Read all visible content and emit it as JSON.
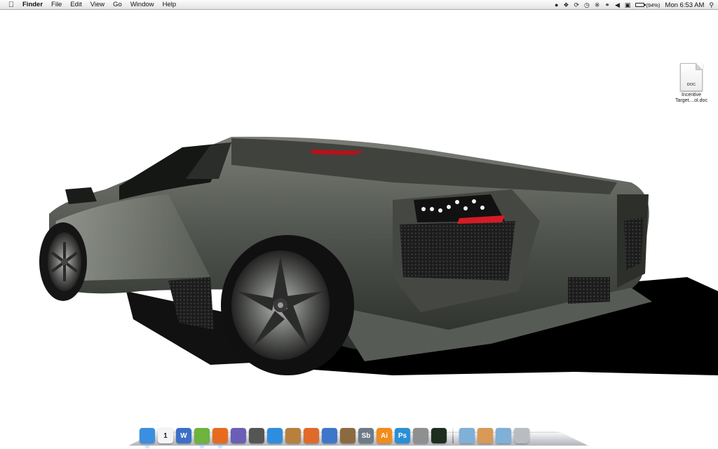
{
  "menubar": {
    "apple_icon": "apple-logo",
    "app_name": "Finder",
    "menus": [
      "File",
      "Edit",
      "View",
      "Go",
      "Window",
      "Help"
    ],
    "status": {
      "icons": [
        "evernote-icon",
        "dropbox-icon",
        "sync-icon",
        "time-machine-icon",
        "bluetooth-icon",
        "wifi-icon",
        "volume-icon",
        "input-menu-icon"
      ],
      "battery_percent": "(94%)",
      "battery_level": 0.94,
      "clock": "Mon 6:53 AM",
      "search_icon": "spotlight-icon"
    }
  },
  "desktop": {
    "wallpaper": "Lamborghini Reventon rear view",
    "icons": [
      {
        "type_tag": "DOC",
        "label_line1": "Incentive",
        "label_line2": "Target....ol.doc"
      }
    ]
  },
  "dock": {
    "apps": [
      {
        "name": "finder-icon",
        "label": "",
        "color": "#3a8fe0",
        "running": true
      },
      {
        "name": "ical-icon",
        "label": "1",
        "color": "#f4f4f4",
        "running": false
      },
      {
        "name": "word-icon",
        "label": "W",
        "color": "#3c6fc7",
        "running": false
      },
      {
        "name": "evernote-icon",
        "label": "",
        "color": "#6cb43d",
        "running": true
      },
      {
        "name": "firefox-icon",
        "label": "",
        "color": "#e86a1f",
        "running": true
      },
      {
        "name": "imovie-icon",
        "label": "",
        "color": "#6b5fb5",
        "running": false
      },
      {
        "name": "microphone-icon",
        "label": "",
        "color": "#555555",
        "running": false
      },
      {
        "name": "itunes-icon",
        "label": "",
        "color": "#2f8de0",
        "running": false
      },
      {
        "name": "garageband-icon",
        "label": "",
        "color": "#b8803a",
        "running": false
      },
      {
        "name": "reason-icon",
        "label": "",
        "color": "#e06a2a",
        "running": false
      },
      {
        "name": "recycle-icon",
        "label": "",
        "color": "#3e76c9",
        "running": false
      },
      {
        "name": "iphoto-icon",
        "label": "",
        "color": "#8c6a40",
        "running": false
      },
      {
        "name": "soundbooth-icon",
        "label": "Sb",
        "color": "#6d7b86",
        "running": false
      },
      {
        "name": "illustrator-icon",
        "label": "Ai",
        "color": "#f28c1a",
        "running": false
      },
      {
        "name": "photoshop-icon",
        "label": "Ps",
        "color": "#2a8fd6",
        "running": false
      },
      {
        "name": "system-preferences-icon",
        "label": "",
        "color": "#8f8f8f",
        "running": false
      },
      {
        "name": "activity-monitor-icon",
        "label": "",
        "color": "#1e2e1e",
        "running": false
      }
    ],
    "stacks": [
      {
        "name": "applications-folder-icon",
        "color": "#7fb0d8"
      },
      {
        "name": "documents-stack-icon",
        "color": "#d89a55"
      },
      {
        "name": "downloads-folder-icon",
        "color": "#7fb0d8"
      },
      {
        "name": "trash-icon",
        "color": "#b9bdc2"
      }
    ]
  }
}
